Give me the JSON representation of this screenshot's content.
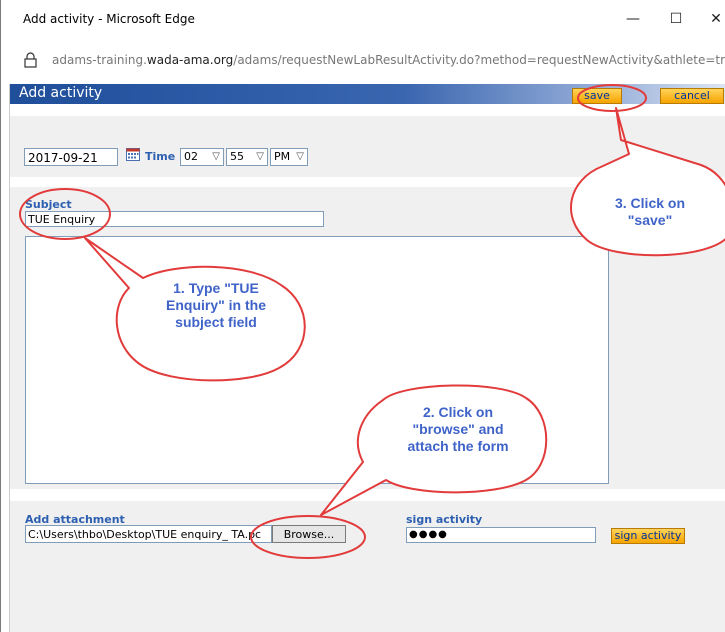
{
  "window": {
    "title": "Add activity - Microsoft Edge",
    "minimize": "—",
    "maximize": "☐",
    "close": "✕"
  },
  "address": {
    "prefix": "adams-training.",
    "host": "wada-ama.org",
    "path": "/adams/requestNewLabResultActivity.do?method=requestNewActivity&athlete=true&athleteId=&"
  },
  "header": {
    "title": "Add activity",
    "save": "save",
    "cancel": "cancel"
  },
  "datetime": {
    "date": "2017-09-21",
    "time_label": "Time",
    "hour": "02",
    "minute": "55",
    "ampm": "PM"
  },
  "subject": {
    "label": "Subject",
    "value": "TUE Enquiry"
  },
  "attachment": {
    "label": "Add attachment",
    "path": "C:\\Users\\thbo\\Desktop\\TUE enquiry_ TA.pc",
    "browse": "Browse..."
  },
  "sign": {
    "label": "sign activity",
    "password": "●●●●",
    "button": "sign activity"
  },
  "callouts": {
    "step1_line1": "1. Type \"TUE",
    "step1_line2": "Enquiry\" in the",
    "step1_line3": "subject field",
    "step2_line1": "2. Click on",
    "step2_line2": "\"browse\" and",
    "step2_line3": "attach the form",
    "step3_line1": "3. Click on",
    "step3_line2": "\"save\""
  },
  "colors": {
    "callout_text": "#3f63c8",
    "callout_stroke": "#e23b3b",
    "button_orange": "#f7a400",
    "label_blue": "#2d5fb0"
  }
}
